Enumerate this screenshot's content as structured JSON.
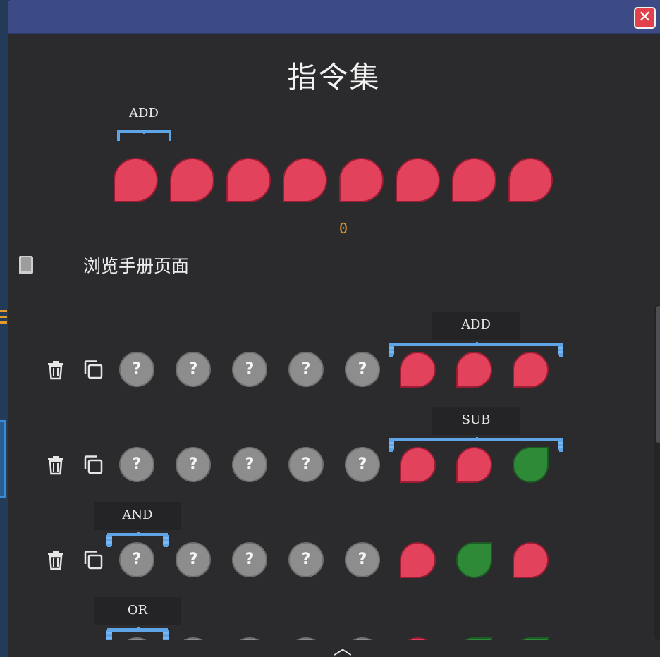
{
  "window": {
    "close_label": "✕"
  },
  "page": {
    "title": "指令集"
  },
  "preview": {
    "op_label": "ADD",
    "value": "0",
    "dots": [
      "red",
      "red",
      "red",
      "red",
      "red",
      "red",
      "red",
      "red"
    ]
  },
  "manual": {
    "label": "浏览手册页面",
    "icon": "book-icon"
  },
  "instructions": [
    {
      "op": "ADD",
      "inputs": [
        "?",
        "?",
        "?",
        "?",
        "?"
      ],
      "pattern": [
        "red",
        "red",
        "red"
      ]
    },
    {
      "op": "SUB",
      "inputs": [
        "?",
        "?",
        "?",
        "?",
        "?"
      ],
      "pattern": [
        "red",
        "red",
        "green"
      ]
    },
    {
      "op": "AND",
      "inputs": [
        "?",
        "?",
        "?",
        "?",
        "?"
      ],
      "pattern": [
        "red",
        "green",
        "red"
      ]
    },
    {
      "op": "OR",
      "inputs": [
        "?",
        "?",
        "?",
        "?",
        "?"
      ],
      "pattern": [
        "red",
        "green",
        "green"
      ]
    }
  ],
  "icons": {
    "delete": "trash-icon",
    "copy": "copy-icon",
    "scroll_up": "chevron-up-icon"
  },
  "colors": {
    "red": "#e3425d",
    "green": "#2e8a37",
    "bracket": "#5fa4e6",
    "value": "#e39a2c"
  }
}
